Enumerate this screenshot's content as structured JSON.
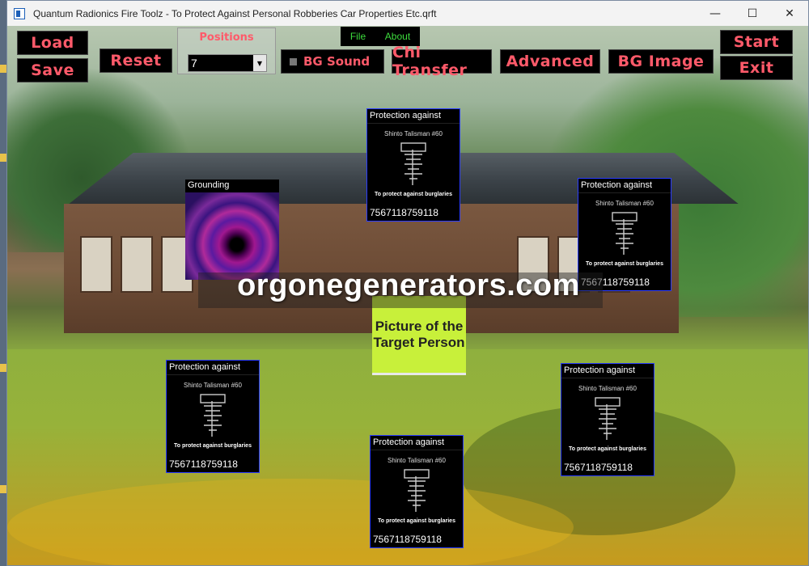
{
  "window": {
    "title": "Quantum Radionics Fire Toolz - To Protect Against Personal Robberies Car Properties Etc.qrft",
    "minimize": "—",
    "maximize": "☐",
    "close": "✕"
  },
  "toolbar": {
    "load": "Load",
    "save": "Save",
    "reset": "Reset",
    "positions_label": "Positions",
    "positions_value": "7",
    "menu_file": "File",
    "menu_about": "About",
    "bg_sound": "BG Sound",
    "chi_transfer": "Chi Transfer",
    "advanced": "Advanced",
    "bg_image": "BG Image",
    "start": "Start",
    "exit": "Exit"
  },
  "grounding": {
    "label": "Grounding"
  },
  "target": {
    "label": "Picture of the Target Person"
  },
  "watermark": "orgonegenerators.com",
  "cards": [
    {
      "head": "Protection against",
      "talisman": "Shinto Talisman #60",
      "caption": "To protect against burglaries",
      "number": "7567118759118"
    },
    {
      "head": "Protection against",
      "talisman": "Shinto Talisman #60",
      "caption": "To protect against burglaries",
      "number": "7567118759118"
    },
    {
      "head": "Protection against",
      "talisman": "Shinto Talisman #60",
      "caption": "To protect against burglaries",
      "number": "7567118759118"
    },
    {
      "head": "Protection against",
      "talisman": "Shinto Talisman #60",
      "caption": "To protect against burglaries",
      "number": "7567118759118"
    },
    {
      "head": "Protection against",
      "talisman": "Shinto Talisman #60",
      "caption": "To protect against burglaries",
      "number": "7567118759118"
    }
  ],
  "colors": {
    "button_text": "#ff5a6a",
    "menu_text": "#3ddc3d",
    "target_bg": "#c8f03a"
  }
}
